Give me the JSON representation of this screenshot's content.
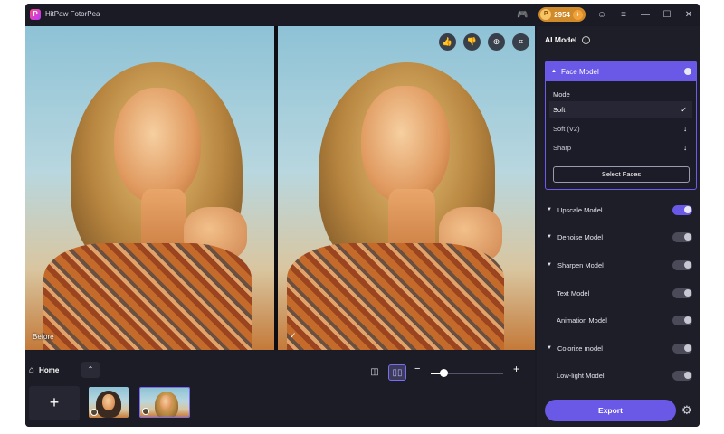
{
  "window": {
    "title": "HitPaw FotorPea",
    "logo": "P"
  },
  "titlebar": {
    "credits": "2954",
    "coin_glyph": "P",
    "icons": [
      "discord-icon",
      "coin-icon",
      "user-icon",
      "menu-icon",
      "minimize-icon",
      "maximize-icon",
      "close-icon"
    ]
  },
  "preview": {
    "before_label": "Before",
    "after_label": "✓",
    "tools": [
      "like-icon",
      "dislike-icon",
      "zoom-icon",
      "crop-icon"
    ]
  },
  "bottom": {
    "home_label": "Home",
    "add_label": "+",
    "zoom_level": 0.18
  },
  "panel": {
    "title": "AI Model",
    "face_model": {
      "label": "Face Model",
      "enabled": true,
      "mode_label": "Mode",
      "modes": [
        {
          "label": "Soft",
          "state": "✓"
        },
        {
          "label": "Soft (V2)",
          "state": "↓"
        },
        {
          "label": "Sharp",
          "state": "↓"
        }
      ],
      "select_faces": "Select Faces"
    },
    "models": [
      {
        "label": "Upscale Model",
        "enabled": true,
        "caret": true
      },
      {
        "label": "Denoise Model",
        "enabled": false,
        "caret": true
      },
      {
        "label": "Sharpen Model",
        "enabled": false,
        "caret": true
      },
      {
        "label": "Text Model",
        "enabled": false,
        "caret": false
      },
      {
        "label": "Animation Model",
        "enabled": false,
        "caret": false
      },
      {
        "label": "Colorize model",
        "enabled": false,
        "caret": true
      },
      {
        "label": "Low-light Model",
        "enabled": false,
        "caret": false
      }
    ],
    "export_label": "Export"
  },
  "colors": {
    "accent": "#6a58e6",
    "background": "#1a1a24",
    "credits": "#d08a2a"
  }
}
